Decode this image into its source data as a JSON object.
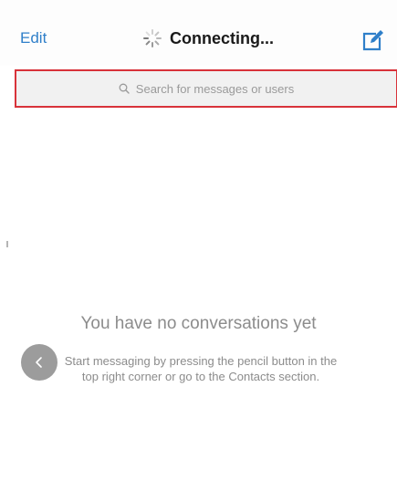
{
  "navbar": {
    "edit_label": "Edit",
    "title": "Connecting...",
    "spinner_icon": "spinner-icon",
    "compose_icon": "pencil-compose-icon",
    "accent_color": "#2f7fc9"
  },
  "search": {
    "placeholder": "Search for messages or users",
    "icon": "search-icon",
    "highlight_color": "#d8323a"
  },
  "empty_state": {
    "title": "You have no conversations yet",
    "subtitle": "Start messaging by pressing the pencil button in the top right corner or go to the Contacts section."
  },
  "back_button": {
    "icon": "chevron-left-icon"
  }
}
